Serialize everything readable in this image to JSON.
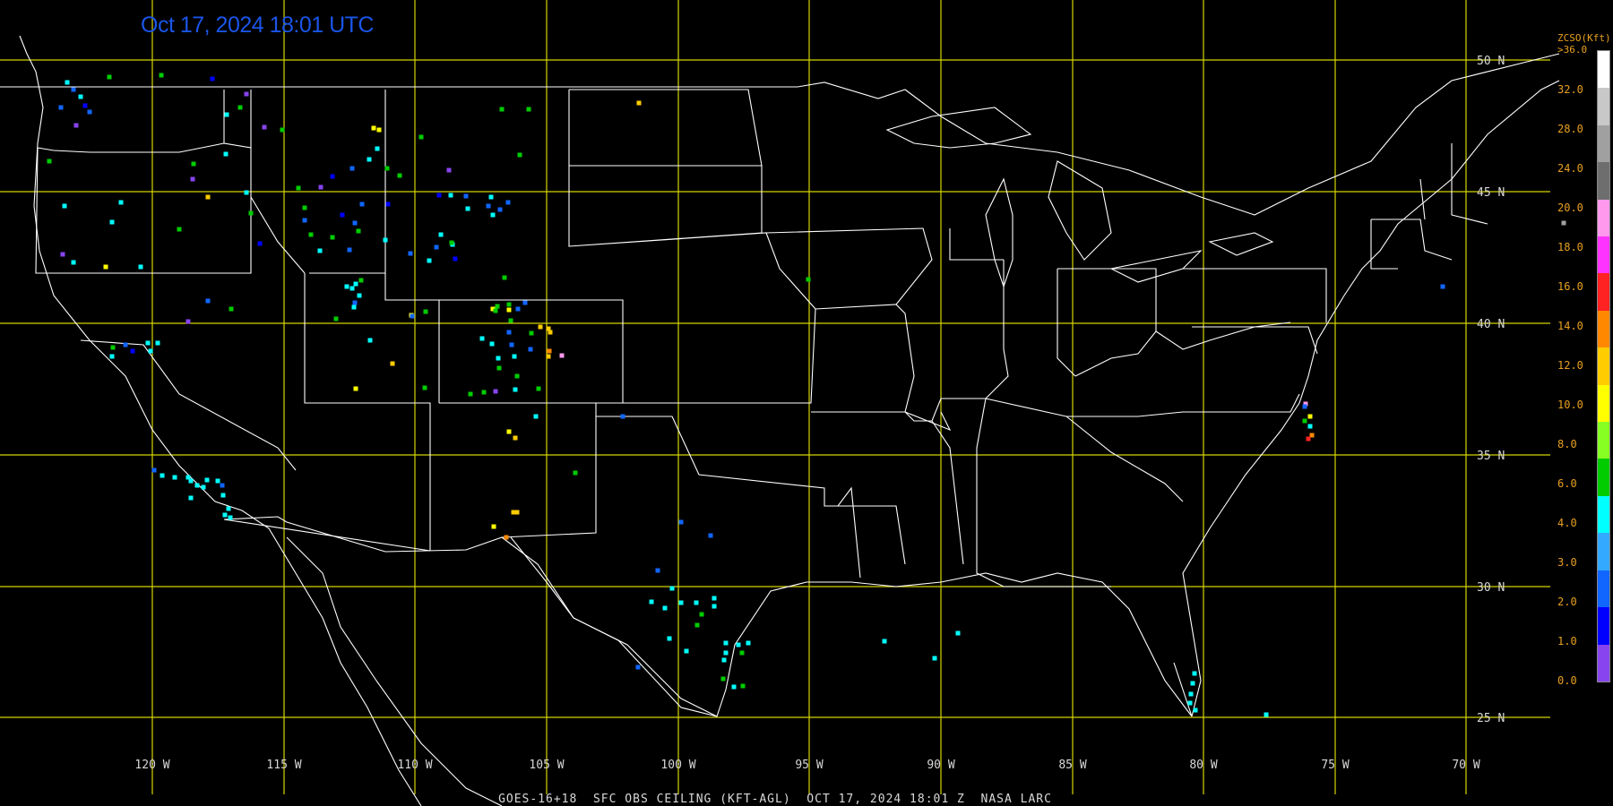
{
  "title": "Oct 17, 2024 18:01 UTC",
  "footer": "GOES-16+18  SFC OBS CEILING (KFT-AGL)  OCT 17, 2024 18:01 Z  NASA LARC",
  "legend": {
    "title_line1": "ZCSO(Kft)",
    "title_line2": ">36.0",
    "labels": [
      "32.0",
      "28.0",
      "24.0",
      "20.0",
      "18.0",
      "16.0",
      "14.0",
      "12.0",
      "10.0",
      "8.0",
      "6.0",
      "4.0",
      "3.0",
      "2.0",
      "1.0",
      "0.0"
    ],
    "colors": [
      "#ffffff",
      "#c8c8c8",
      "#a0a0a0",
      "#6e6e6e",
      "#ff99ee",
      "#ff33ff",
      "#ff2222",
      "#ff8800",
      "#ffcc00",
      "#ffff00",
      "#88ff22",
      "#00cc00",
      "#00ffff",
      "#33aaff",
      "#1166ff",
      "#0000ff",
      "#8844ee"
    ]
  },
  "grid": {
    "lat_labels": [
      "50 N",
      "45 N",
      "40 N",
      "35 N",
      "30 N",
      "25 N"
    ],
    "lon_labels": [
      "120 W",
      "115 W",
      "110 W",
      "105 W",
      "100 W",
      "95 W",
      "90 W",
      "85 W",
      "80 W",
      "75 W",
      "70 W"
    ],
    "color": "#d4d400"
  },
  "colors": {
    "background": "#000000",
    "boundary": "#ffffff",
    "title": "#1a55e8",
    "label": "#e8a020"
  }
}
